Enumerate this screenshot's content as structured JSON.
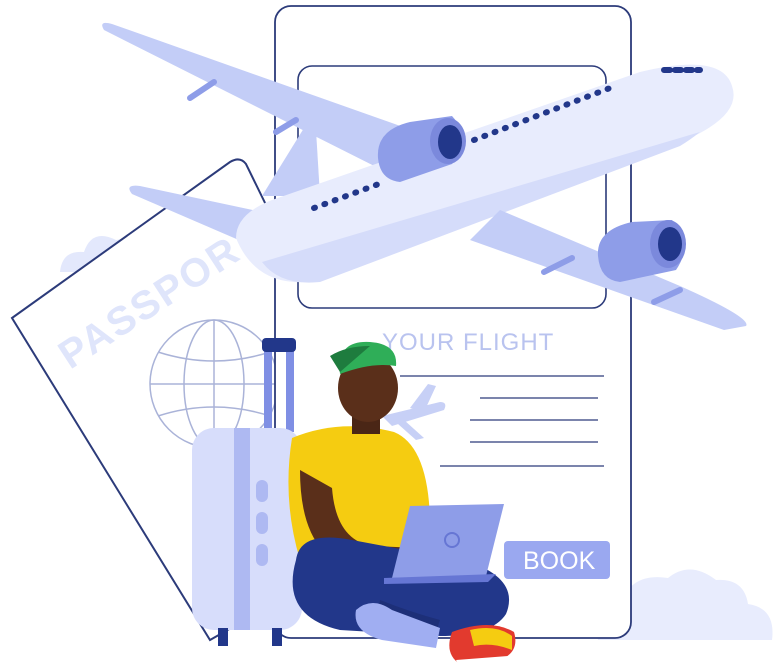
{
  "illustration": {
    "passport_text": "PASSPOR",
    "phone_heading": "YOUR  FLIGHT",
    "book_button": "BOOK"
  },
  "colors": {
    "outline": "#2c3b7a",
    "plane_light": "#e8ecfd",
    "plane_mid": "#c3cdf7",
    "plane_dark": "#8e9de8",
    "navy": "#22378a",
    "shirt": "#f5cc11",
    "skin": "#5a2f1a",
    "cap": "#2fae58",
    "book_button": "#9aa8f0"
  },
  "icons": [
    "airplane-icon",
    "passport-icon",
    "globe-icon",
    "suitcase-icon",
    "laptop-icon",
    "cloud-icon"
  ]
}
